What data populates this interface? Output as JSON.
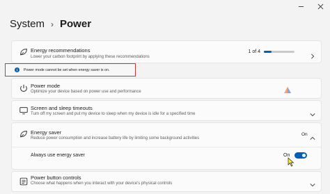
{
  "window": {
    "minimize_icon": "minimize-icon",
    "close_icon": "close-icon"
  },
  "breadcrumb": {
    "parent": "System",
    "separator": "›",
    "current": "Power"
  },
  "energy_recommendations": {
    "title": "Energy recommendations",
    "description": "Lower your carbon footprint by applying these recommendations",
    "progress_text": "1 of 4",
    "progress_fraction": 0.25
  },
  "notice": {
    "text": "Power mode cannot be set when energy saver is on."
  },
  "power_mode": {
    "title": "Power mode",
    "description": "Optimize your device based on power use and performance"
  },
  "screen_sleep": {
    "title": "Screen and sleep timeouts",
    "description": "Turn off my screen and put my device to sleep when my device is idle for a specified time"
  },
  "energy_saver": {
    "title": "Energy saver",
    "description": "Reduce power consumption and increase battery life by limiting some background activities",
    "state": "On",
    "always_label": "Always use energy saver",
    "always_state": "On",
    "always_on": true
  },
  "power_button": {
    "title": "Power button controls",
    "description": "Choose what happens when you interact with your device's physical controls"
  },
  "colors": {
    "accent": "#005fb8",
    "notice_border": "#d0323a"
  }
}
